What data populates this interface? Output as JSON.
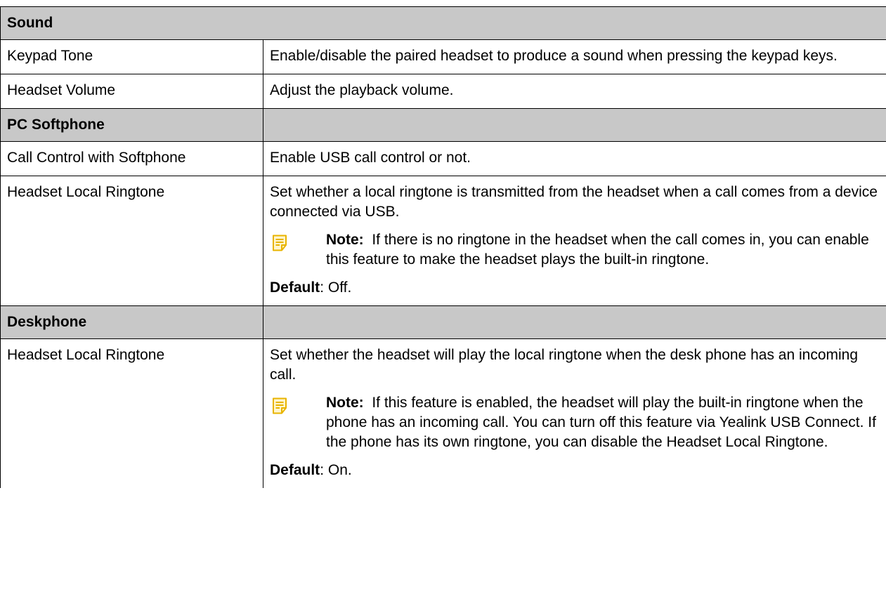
{
  "sections": [
    {
      "title": "Sound",
      "rows": [
        {
          "name": "Keypad Tone",
          "desc": "Enable/disable the paired headset to produce a sound when pressing the keypad keys."
        },
        {
          "name": "Headset Volume",
          "desc": "Adjust the playback volume."
        }
      ]
    },
    {
      "title": "PC Softphone",
      "rows": [
        {
          "name": "Call Control with Softphone",
          "desc": "Enable USB call control or not."
        },
        {
          "name": "Headset Local Ringtone",
          "desc": "Set whether a local ringtone is transmitted from the headset when a call comes from a device connected via USB.",
          "note_label": "Note:",
          "note_text": "If there is no ringtone in the headset when the call comes in, you can enable this feature to make the headset plays the built-in ringtone.",
          "default_label": "Default",
          "default_value": ": Off."
        }
      ]
    },
    {
      "title": "Deskphone",
      "rows": [
        {
          "name": "Headset Local Ringtone",
          "desc": "Set whether the headset will play the local ringtone when the desk phone has an incoming call.",
          "note_label": "Note:",
          "note_text": "If this feature is enabled, the headset will play the built-in ringtone when the phone has an incoming call. You can turn off this feature via Yealink USB Connect. If the phone has its own ringtone, you can disable the Headset Local Ringtone.",
          "default_label": "Default",
          "default_value": ": On."
        }
      ]
    }
  ],
  "note_icon": "note-icon",
  "colors": {
    "header_bg": "#c8c8c8",
    "note_icon": "#e8b400",
    "border": "#000000"
  }
}
